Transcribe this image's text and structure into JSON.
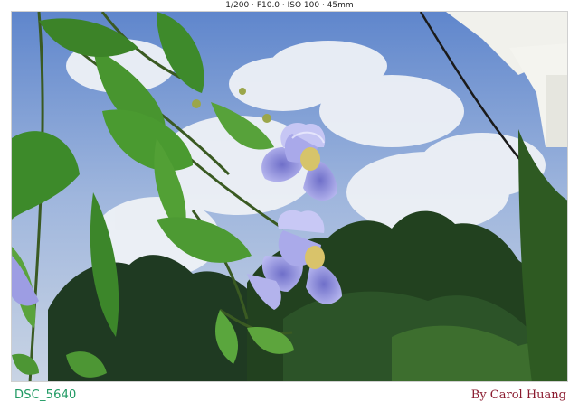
{
  "exif_line": "1/200 · F10.0 · ISO 100 · 45mm",
  "photo": {
    "subject": "Flower",
    "colors": {
      "sky": "#6c8fcf",
      "cloud": "#eef1f6",
      "foliage_dark": "#1f3b1f",
      "leaf": "#3f8b2c",
      "petal": "#8f8fdc",
      "petal_light": "#b6b6ee",
      "throat": "#d9c46a"
    }
  },
  "caption": {
    "filename": "DSC_5640",
    "author": "By Carol Huang"
  }
}
